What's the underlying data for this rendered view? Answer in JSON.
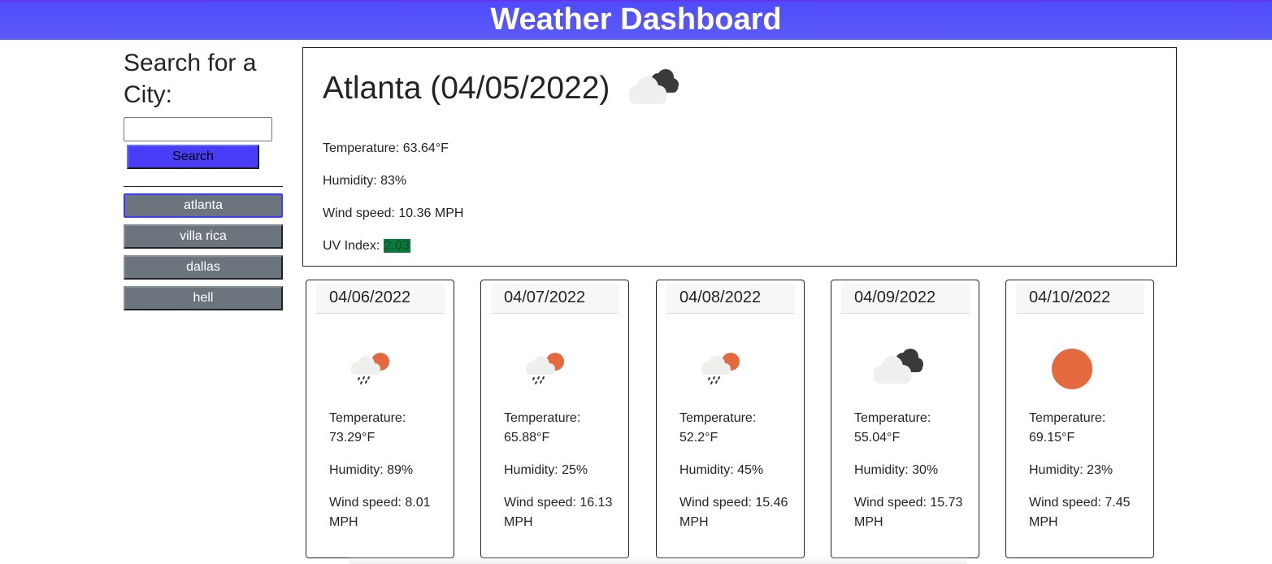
{
  "header": {
    "title": "Weather Dashboard"
  },
  "search": {
    "heading": "Search for a City:",
    "input_value": "",
    "button_label": "Search"
  },
  "history": [
    {
      "label": "atlanta",
      "active": true
    },
    {
      "label": "villa rica",
      "active": false
    },
    {
      "label": "dallas",
      "active": false
    },
    {
      "label": "hell",
      "active": false
    }
  ],
  "current": {
    "title": "Atlanta (04/05/2022)",
    "icon": "broken-clouds-icon",
    "temperature": "Temperature: 63.64°F",
    "humidity": "Humidity: 83%",
    "wind": "Wind speed: 10.36 MPH",
    "uv_label": "UV Index: ",
    "uv_value": "2.03",
    "uv_color": "#0b7a3b"
  },
  "forecast": [
    {
      "date": "04/06/2022",
      "icon": "rain-sun-icon",
      "temperature": "Temperature: 73.29°F",
      "humidity": "Humidity: 89%",
      "wind": "Wind speed: 8.01 MPH"
    },
    {
      "date": "04/07/2022",
      "icon": "rain-sun-icon",
      "temperature": "Temperature: 65.88°F",
      "humidity": "Humidity: 25%",
      "wind": "Wind speed: 16.13 MPH"
    },
    {
      "date": "04/08/2022",
      "icon": "rain-sun-icon",
      "temperature": "Temperature: 52.2°F",
      "humidity": "Humidity: 45%",
      "wind": "Wind speed: 15.46 MPH"
    },
    {
      "date": "04/09/2022",
      "icon": "broken-clouds-icon",
      "temperature": "Temperature: 55.04°F",
      "humidity": "Humidity: 30%",
      "wind": "Wind speed: 15.73 MPH"
    },
    {
      "date": "04/10/2022",
      "icon": "clear-sun-icon",
      "temperature": "Temperature: 69.15°F",
      "humidity": "Humidity: 23%",
      "wind": "Wind speed: 7.45 MPH"
    }
  ],
  "colors": {
    "header_bg": "#5b5bf6",
    "search_button": "#4a3df7",
    "history_button": "#6c757d",
    "sun": "#e4693f"
  }
}
